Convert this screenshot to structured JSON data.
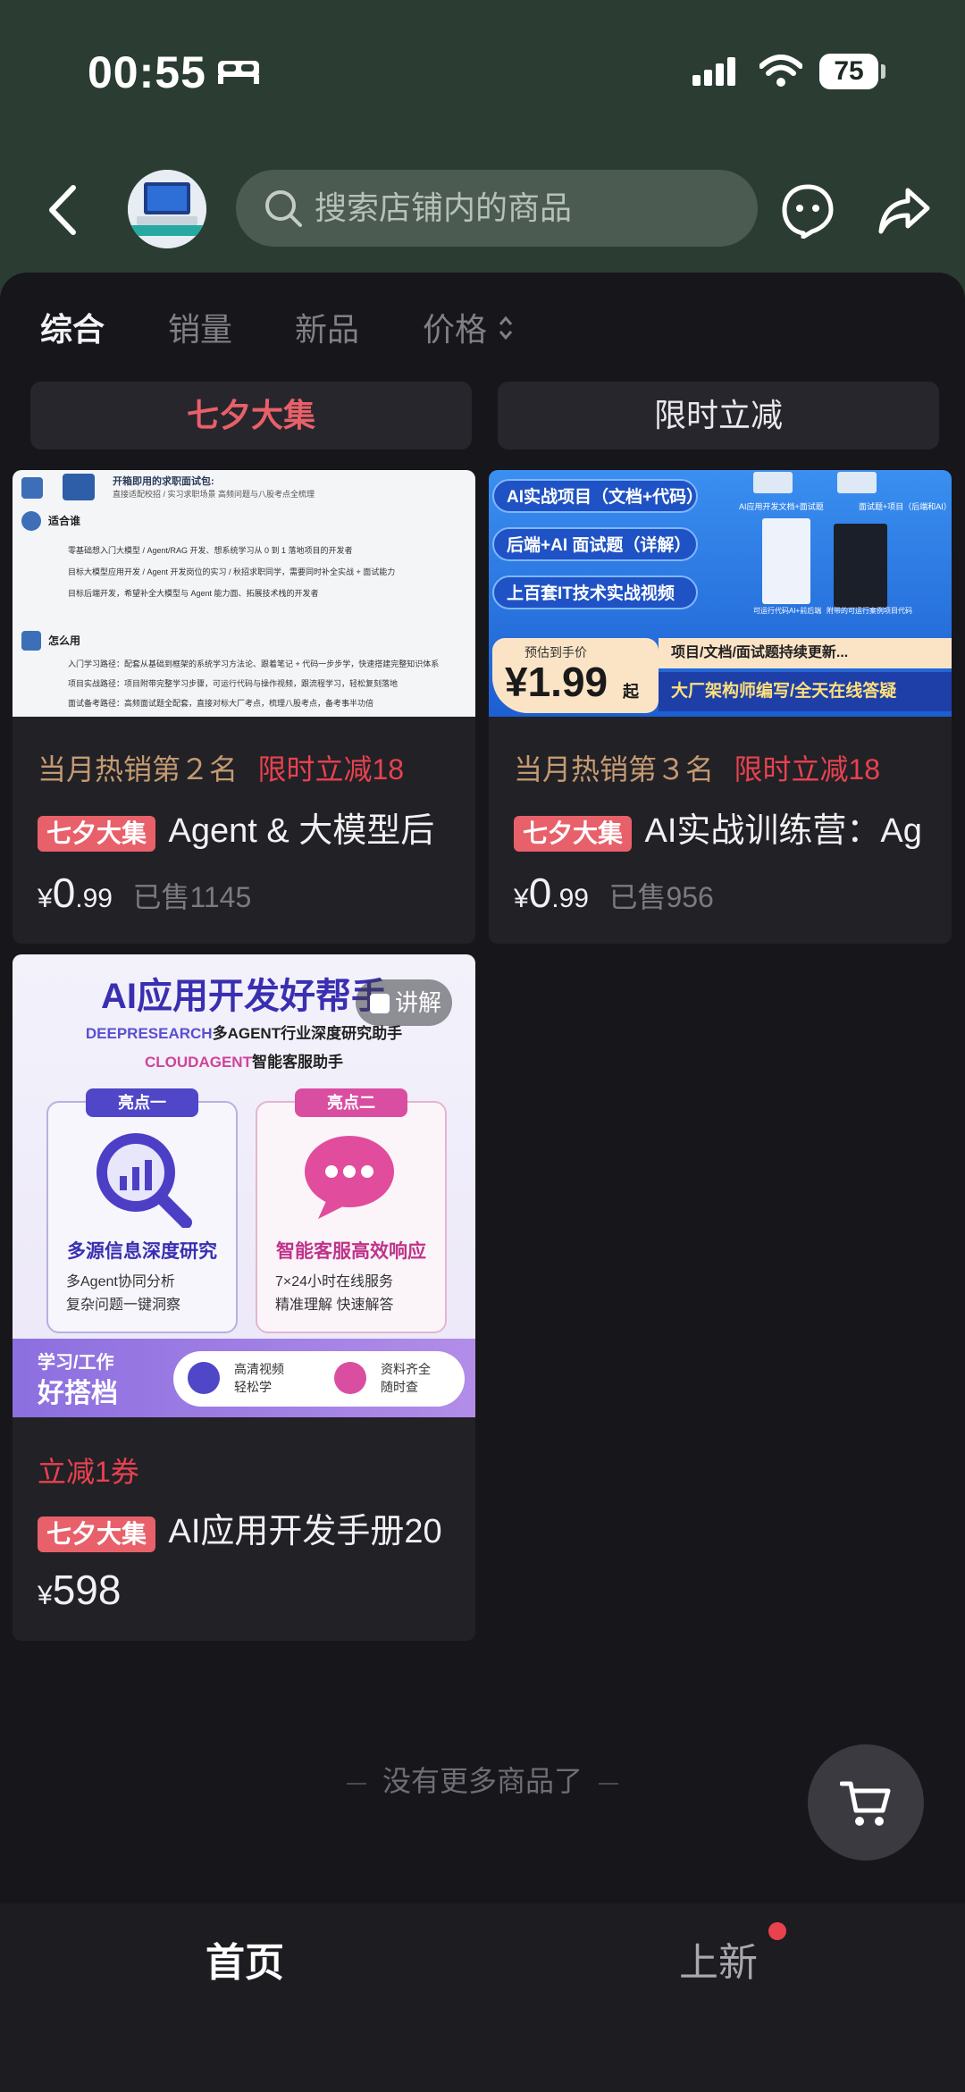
{
  "status": {
    "time": "00:55",
    "battery": "75"
  },
  "header": {
    "search_placeholder": "搜索店铺内的商品"
  },
  "tabs": [
    "综合",
    "销量",
    "新品",
    "价格"
  ],
  "promo": {
    "left": "七夕大集",
    "right": "限时立减",
    "left_color": "#e8606a"
  },
  "products": [
    {
      "rank": "当月热销第２名",
      "promo": "限时立减18",
      "tag": "七夕大集",
      "title": "Agent & 大模型后",
      "price_symbol": "¥",
      "price_int": "0",
      "price_dec": ".99",
      "sold": "已售1145",
      "image": {
        "row1a": "开箱即用的求职面试包:",
        "row1b": "直接适配校招 / 实习求职场景 高频问题与八股考点全梳理",
        "section1": "适合谁",
        "s1_items": [
          "零基础想入门大模型 / Agent/RAG 开发、想系统学习从 0 到 1 落地项目的开发者",
          "目标大模型应用开发 / Agent 开发岗位的实习 / 秋招求职同学，需要同时补全实战 + 面试能力",
          "目标后端开发，希望补全大模型与 Agent 能力面、拓展技术栈的开发者"
        ],
        "section2": "怎么用",
        "s2_items": [
          "入门学习路径：配套从基础到框架的系统学习方法论、跟着笔记 + 代码一步步学，快速搭建完整知识体系",
          "项目实战路径：项目附带完整学习步骤，可运行代码与操作视频，跟流程学习，轻松复刻落地",
          "面试备考路径：高频面试题全配套，直接对标大厂考点，梳理八股考点，备考事半功倍"
        ]
      }
    },
    {
      "rank": "当月热销第３名",
      "promo": "限时立减18",
      "tag": "七夕大集",
      "title": "AI实战训练营：Ag",
      "price_symbol": "¥",
      "price_int": "0",
      "price_dec": ".99",
      "sold": "已售956",
      "image": {
        "pills": [
          "AI实战项目（文档+代码）",
          "后端+AI 面试题（详解）",
          "上百套IT技术实战视频"
        ],
        "cap1": "AI应用开发文档+面试题",
        "cap2": "面试题+项目（后端和AI）",
        "cap3": "可运行代码AI+前后端",
        "cap4": "附带的可运行案例项目代码",
        "price_label": "预估到手价",
        "price": "¥1.99",
        "price_suffix": "起",
        "banner1": "项目/文档/面试题持续更新...",
        "banner2": "大厂架构师编写/全天在线答疑"
      }
    },
    {
      "promo": "立减1券",
      "tag": "七夕大集",
      "title": "AI应用开发手册20",
      "price_symbol": "¥",
      "price_int": "598",
      "live_badge": "讲解",
      "image": {
        "headline": "AI应用开发好帮手",
        "sub1a": "DEEPRESEARCH",
        "sub1b": "多AGENT行业深度研究助手",
        "sub2a": "CLOUDAGENT",
        "sub2b": "智能客服助手",
        "hl1": "亮点一",
        "hl2": "亮点二",
        "f1_title": "多源信息深度研究",
        "f1_items": [
          "多Agent协同分析",
          "复杂问题一键洞察"
        ],
        "f2_title": "智能客服高效响应",
        "f2_items": [
          "7×24小时在线服务",
          "精准理解 快速解答"
        ],
        "bottom_a": "学习/工作",
        "bottom_b": "好搭档",
        "b1a": "高清视频",
        "b1b": "轻松学",
        "b2a": "资料齐全",
        "b2b": "随时查"
      }
    }
  ],
  "end_text": "没有更多商品了",
  "nav": {
    "home": "首页",
    "new": "上新"
  }
}
